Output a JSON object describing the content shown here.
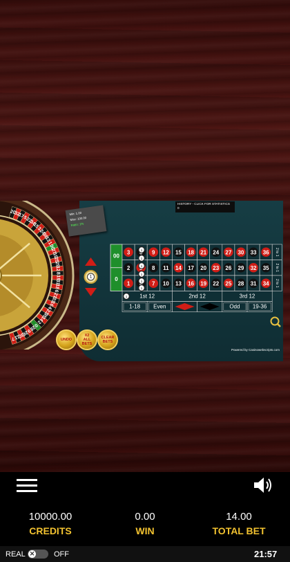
{
  "history": {
    "title": "HISTORY - CLICK FOR STATISTICS",
    "value": "0"
  },
  "limits": {
    "min": "Min: 1.00",
    "max": "Max: 100.00",
    "ratio": "Ratio: 1%"
  },
  "wheel_numbers": [
    "20",
    "32",
    "17",
    "5",
    "22",
    "34",
    "15",
    "3",
    "24",
    "36",
    "13",
    "1",
    "00",
    "27",
    "10",
    "25",
    "29",
    "12",
    "8",
    "19",
    "31",
    "18",
    "6",
    "21",
    "33",
    "16",
    "4",
    "23",
    "35",
    "14",
    "2",
    "0",
    "28",
    "9",
    "26",
    "30",
    "11",
    "7"
  ],
  "center_chip": {
    "value": "1"
  },
  "buttons": {
    "undo": "UNDO",
    "x2": "X2\nALL BETS",
    "clear": "CLEAR\nBETS"
  },
  "table": {
    "zeros": [
      "00",
      "0"
    ],
    "rows": [
      [
        "3",
        "6",
        "9",
        "12",
        "15",
        "18",
        "21",
        "24",
        "27",
        "30",
        "33",
        "36"
      ],
      [
        "2",
        "5",
        "8",
        "11",
        "14",
        "17",
        "20",
        "23",
        "26",
        "29",
        "32",
        "35"
      ],
      [
        "1",
        "4",
        "7",
        "10",
        "13",
        "16",
        "19",
        "22",
        "25",
        "28",
        "31",
        "34"
      ]
    ],
    "red_numbers": [
      "1",
      "3",
      "5",
      "7",
      "9",
      "12",
      "14",
      "16",
      "18",
      "19",
      "21",
      "23",
      "25",
      "27",
      "30",
      "32",
      "34",
      "36"
    ],
    "column_bets": [
      "2 to 1",
      "2 to 1",
      "2 to 1"
    ],
    "dozens": [
      "1st 12",
      "2nd 12",
      "3rd 12"
    ],
    "outside": [
      "1-18",
      "Even",
      "",
      "",
      "Odd",
      "19-36"
    ],
    "placed_chip": "1"
  },
  "powered_by": "Powered by Casinowebscripts.com",
  "footer": {
    "credits_value": "10000.00",
    "credits_label": "CREDITS",
    "win_value": "0.00",
    "win_label": "WIN",
    "total_bet_value": "14.00",
    "total_bet_label": "TOTAL BET"
  },
  "status": {
    "real": "REAL",
    "toggle_icon": "x-icon",
    "off": "OFF",
    "time": "21:57"
  },
  "colors": {
    "red": "#d01d16",
    "black": "#111111",
    "green": "#1f8f2b",
    "felt": "#153a40",
    "gold": "#f2c230"
  }
}
